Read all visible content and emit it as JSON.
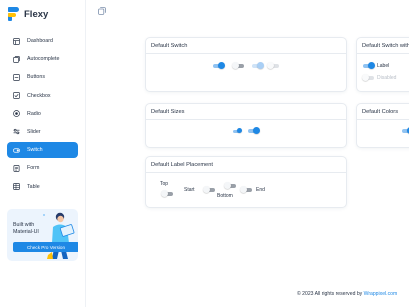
{
  "brand": {
    "name": "Flexy"
  },
  "sidebar": {
    "items": [
      {
        "label": "Dashboard",
        "icon": "dashboard-icon",
        "active": false
      },
      {
        "label": "Autocomplete",
        "icon": "autocomplete-icon",
        "active": false
      },
      {
        "label": "Buttons",
        "icon": "buttons-icon",
        "active": false
      },
      {
        "label": "Checkbox",
        "icon": "checkbox-icon",
        "active": false
      },
      {
        "label": "Radio",
        "icon": "radio-icon",
        "active": false
      },
      {
        "label": "Slider",
        "icon": "slider-icon",
        "active": false
      },
      {
        "label": "Switch",
        "icon": "switch-icon",
        "active": true
      },
      {
        "label": "Form",
        "icon": "form-icon",
        "active": false
      },
      {
        "label": "Table",
        "icon": "table-icon",
        "active": false
      }
    ],
    "promo": {
      "text": "Built with Material-UI",
      "button": "Check Pro Version"
    }
  },
  "cards": {
    "default_switch": {
      "title": "Default Switch"
    },
    "default_switch_label": {
      "title": "Default Switch with Label",
      "label_on": "Label",
      "label_disabled": "Disabled"
    },
    "default_sizes": {
      "title": "Default Sizes"
    },
    "default_colors": {
      "title": "Default Colors"
    },
    "label_placement": {
      "title": "Default Label Placement",
      "top": "Top",
      "start": "Start",
      "bottom": "Bottom",
      "end": "End"
    }
  },
  "footer": {
    "text": "© 2023 All rights reserved by ",
    "link": "Wrappixel.com"
  },
  "colors": {
    "primary": "#1e88e5",
    "text": "#2a3547",
    "border": "#e7ebf0",
    "promo_bg": "#ecf4fd"
  }
}
